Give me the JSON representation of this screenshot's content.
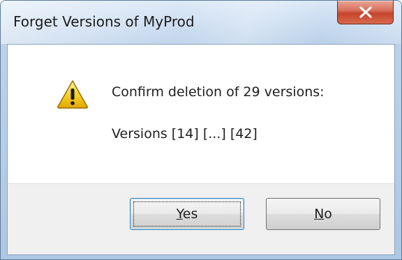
{
  "window": {
    "title": "Forget Versions of MyProd"
  },
  "message": {
    "line1": "Confirm deletion of 29 versions:",
    "line2": "Versions  [14]  [...]  [42]"
  },
  "buttons": {
    "yes": {
      "accel": "Y",
      "rest": "es"
    },
    "no": {
      "accel": "N",
      "rest": "o"
    }
  },
  "icons": {
    "close": "close-icon",
    "warning": "warning-icon"
  }
}
